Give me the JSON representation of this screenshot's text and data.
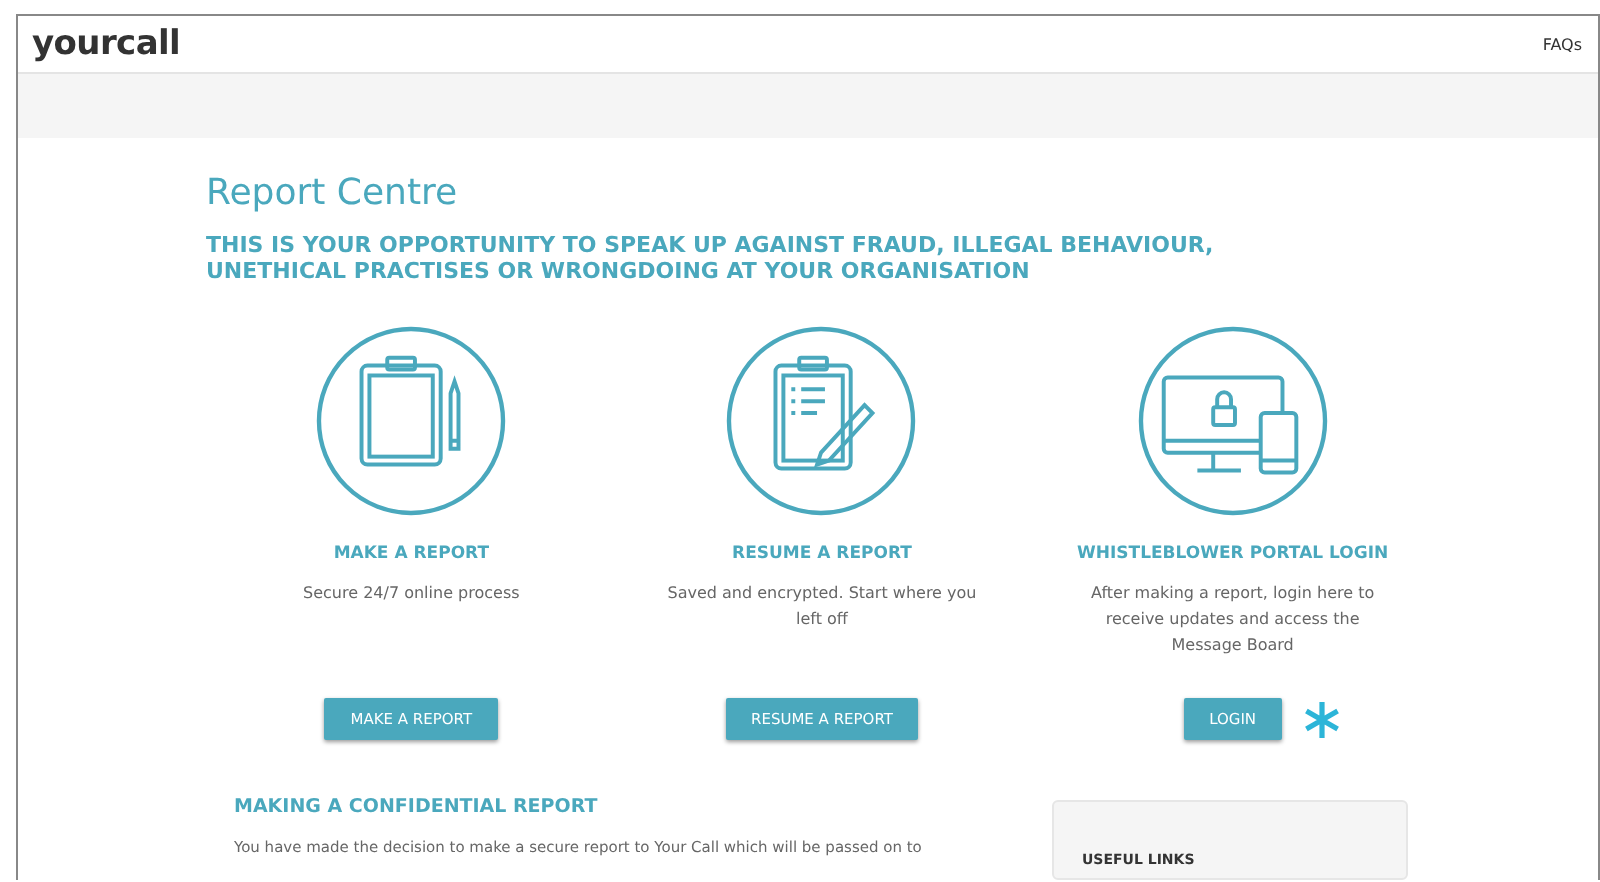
{
  "header": {
    "logo": "yourcall",
    "link": "FAQs"
  },
  "page": {
    "title": "Report Centre",
    "intro": "THIS IS YOUR OPPORTUNITY TO SPEAK UP AGAINST FRAUD, ILLEGAL BEHAVIOUR, UNETHICAL PRACTISES OR WRONGDOING AT YOUR ORGANISATION"
  },
  "options": [
    {
      "kind": "clipboard",
      "title": "MAKE A REPORT",
      "description": "Secure 24/7 online process",
      "button": "MAKE A REPORT",
      "asterisk": false
    },
    {
      "kind": "checklist",
      "title": "RESUME A REPORT",
      "description": "Saved and encrypted. Start where you left off",
      "button": "RESUME A REPORT",
      "asterisk": false
    },
    {
      "kind": "devices",
      "title": "WHISTLEBLOWER PORTAL LOGIN",
      "description": "After making a report, login here to receive updates and access the Message Board",
      "button": "LOGIN",
      "asterisk": true
    }
  ],
  "section": {
    "heading": "MAKING A CONFIDENTIAL REPORT",
    "paragraph": "You have made the decision to make a secure report to Your Call which will be passed on to"
  },
  "sidebar": {
    "heading": "USEFUL LINKS"
  }
}
